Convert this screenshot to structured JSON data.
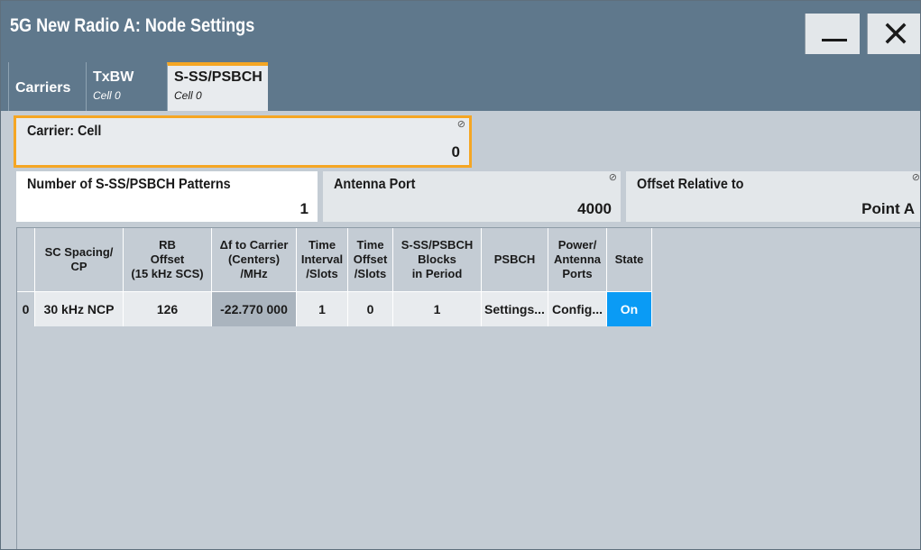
{
  "window": {
    "title": "5G New Radio A: Node Settings"
  },
  "tabs": [
    {
      "label": "Carriers",
      "sub": ""
    },
    {
      "label": "TxBW",
      "sub": "Cell 0"
    },
    {
      "label": "S-SS/PSBCH",
      "sub": "Cell 0",
      "active": true
    }
  ],
  "fields": {
    "carrier": {
      "label": "Carrier: Cell",
      "value": "0"
    },
    "patterns": {
      "label": "Number of S-SS/PSBCH Patterns",
      "value": "1"
    },
    "antenna": {
      "label": "Antenna Port",
      "value": "4000"
    },
    "offset": {
      "label": "Offset Relative to",
      "value": "Point A"
    }
  },
  "table": {
    "headers": [
      "",
      "SC Spacing/\nCP",
      "RB\nOffset\n(15 kHz SCS)",
      "Δf to Carrier\n(Centers)\n/MHz",
      "Time\nInterval\n/Slots",
      "Time\nOffset\n/Slots",
      "S-SS/PSBCH\nBlocks\nin Period",
      "PSBCH",
      "Power/\nAntenna\nPorts",
      "State"
    ],
    "rows": [
      [
        "0",
        "30 kHz NCP",
        "126",
        "-22.770 000",
        "1",
        "0",
        "1",
        "Settings...",
        "Config...",
        "On"
      ]
    ]
  },
  "colors": {
    "titlebar": "#5f788c",
    "accent_orange": "#f5a623",
    "state_on": "#0a9bf5",
    "panel": "#c4ccd4"
  }
}
